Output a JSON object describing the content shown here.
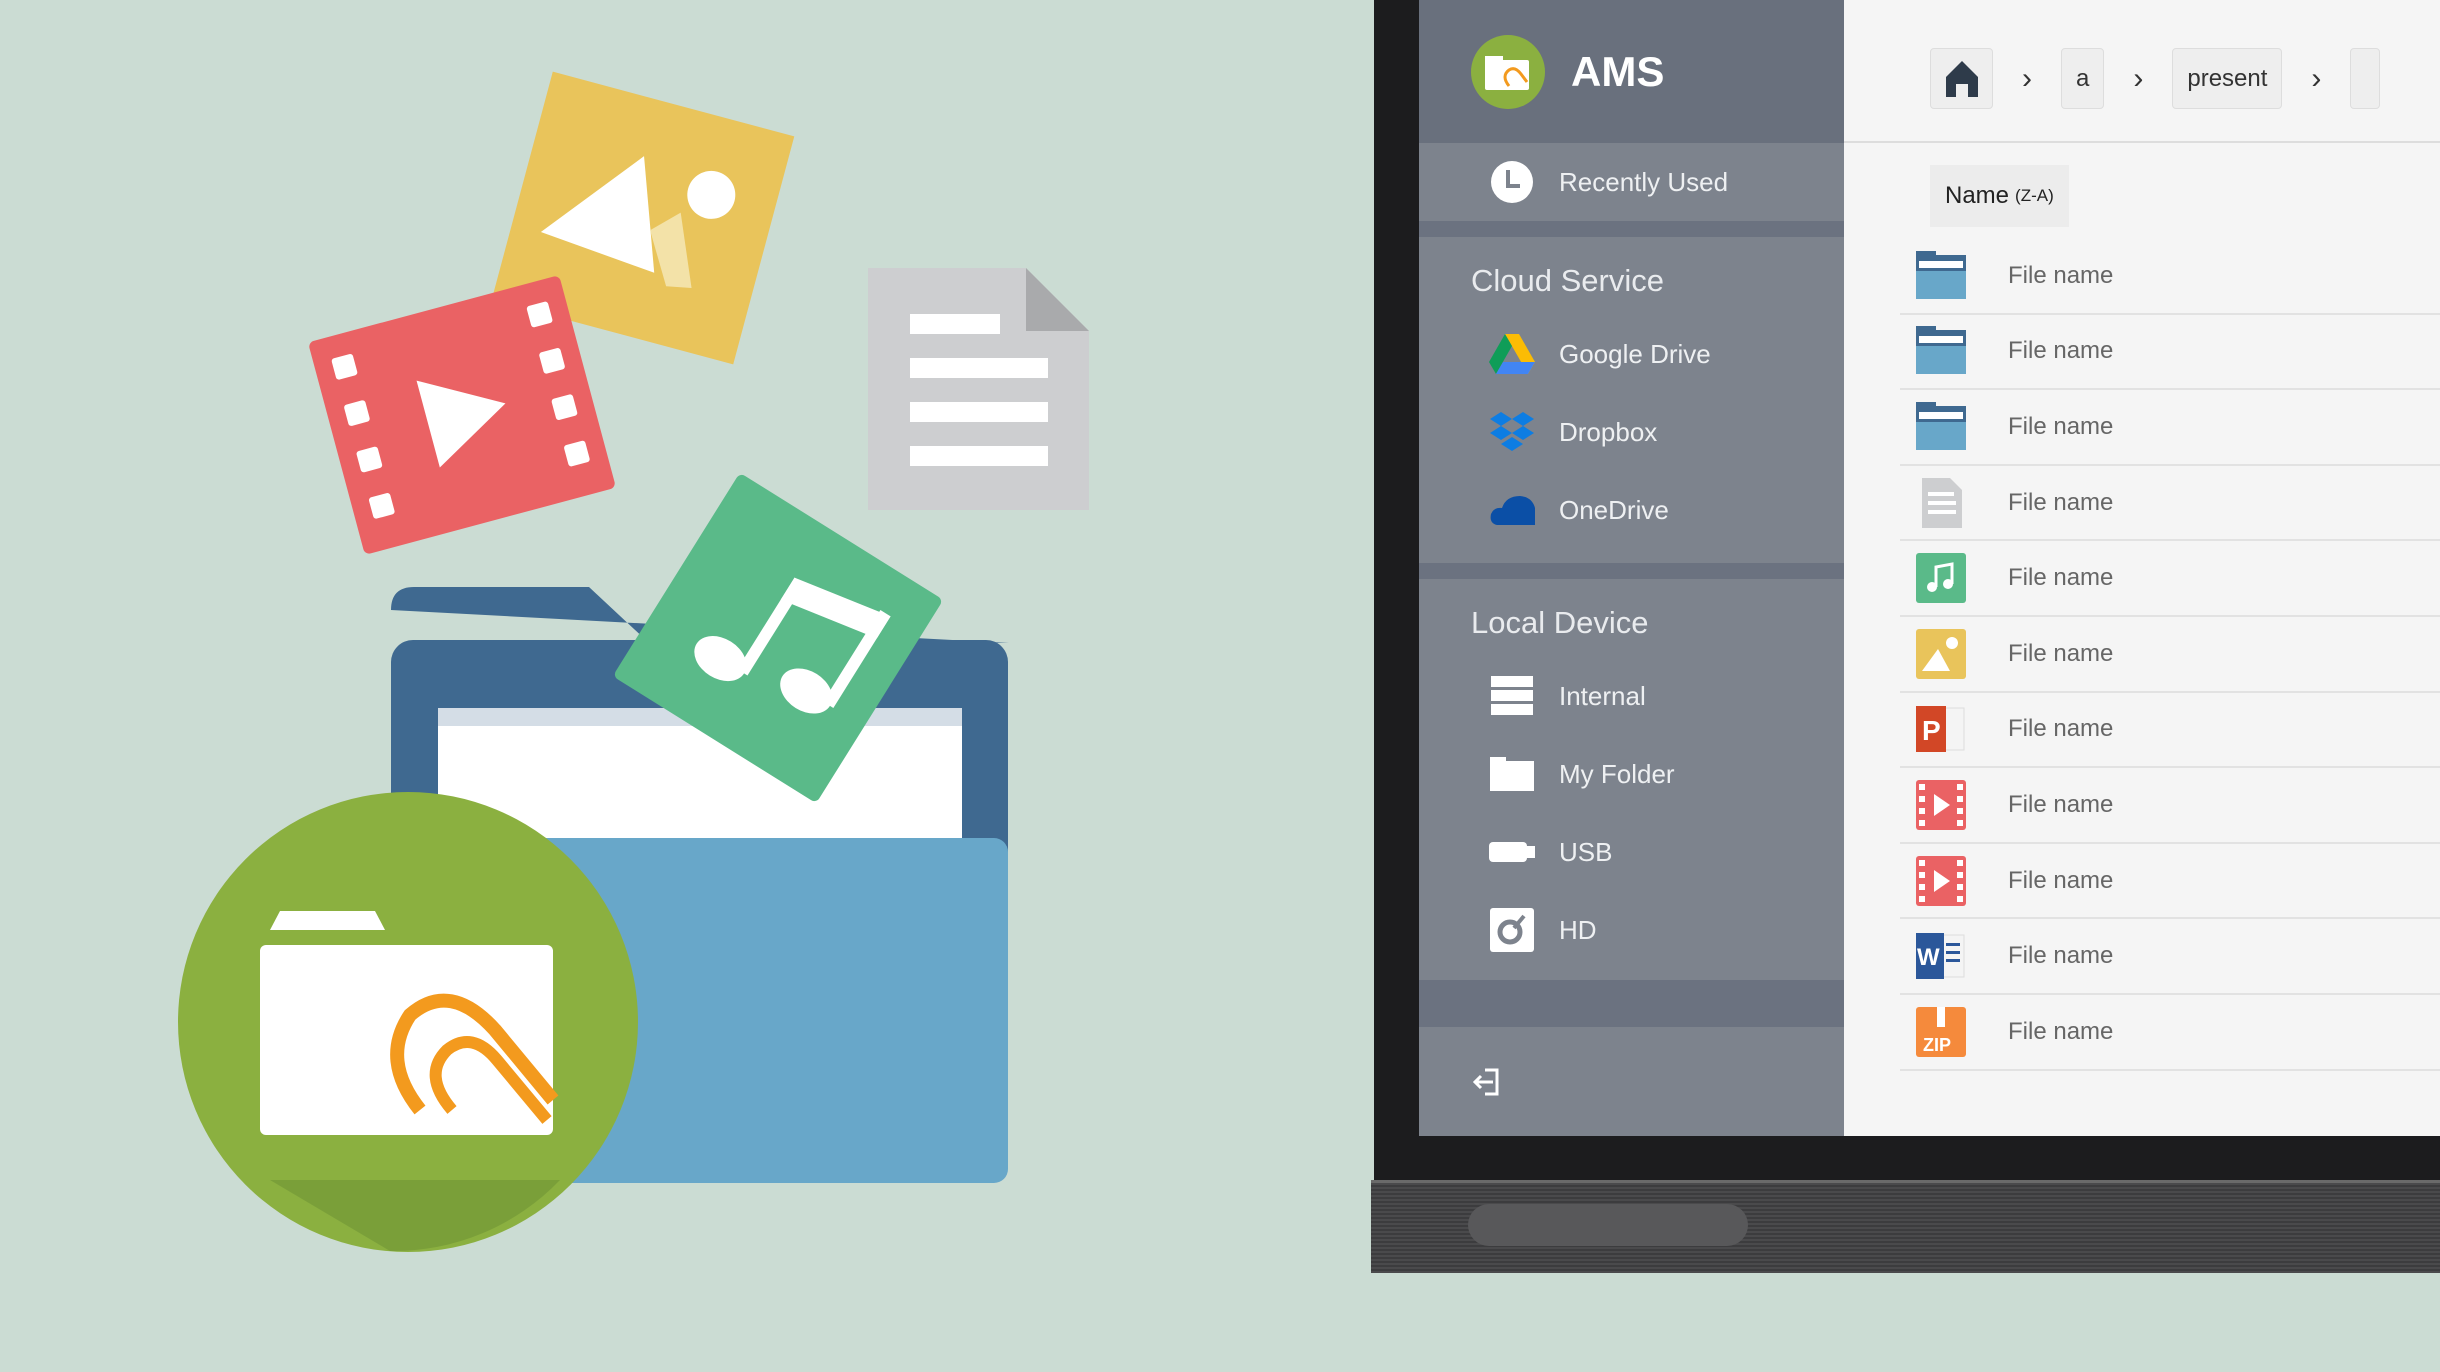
{
  "app": {
    "title": "AMS",
    "logo": "ams-folder-clip-logo"
  },
  "sidebar": {
    "recent": {
      "label": "Recently Used",
      "icon": "clock-icon"
    },
    "cloud": {
      "heading": "Cloud Service",
      "items": [
        {
          "label": "Google Drive",
          "icon": "google-drive-icon"
        },
        {
          "label": "Dropbox",
          "icon": "dropbox-icon"
        },
        {
          "label": "OneDrive",
          "icon": "onedrive-icon"
        }
      ]
    },
    "local": {
      "heading": "Local Device",
      "items": [
        {
          "label": "Internal",
          "icon": "storage-icon"
        },
        {
          "label": "My Folder",
          "icon": "folder-icon"
        },
        {
          "label": "USB",
          "icon": "usb-icon"
        },
        {
          "label": "HD",
          "icon": "hard-disk-icon"
        }
      ]
    },
    "exit_icon": "exit-icon"
  },
  "breadcrumb": {
    "home_icon": "home-icon",
    "items": [
      "a",
      "present"
    ]
  },
  "sort": {
    "label": "Name",
    "order": "(Z-A)"
  },
  "files": [
    {
      "name": "File name",
      "type": "folder"
    },
    {
      "name": "File name",
      "type": "folder"
    },
    {
      "name": "File name",
      "type": "folder"
    },
    {
      "name": "File name",
      "type": "document"
    },
    {
      "name": "File name",
      "type": "audio"
    },
    {
      "name": "File name",
      "type": "image"
    },
    {
      "name": "File name",
      "type": "powerpoint"
    },
    {
      "name": "File name",
      "type": "video"
    },
    {
      "name": "File name",
      "type": "video"
    },
    {
      "name": "File name",
      "type": "word"
    },
    {
      "name": "File name",
      "type": "zip"
    }
  ],
  "colors": {
    "background": "#cbdcd3",
    "sidebar": "#6b7280",
    "logo_green": "#8bb040",
    "folder_blue": "#68a7c9"
  }
}
